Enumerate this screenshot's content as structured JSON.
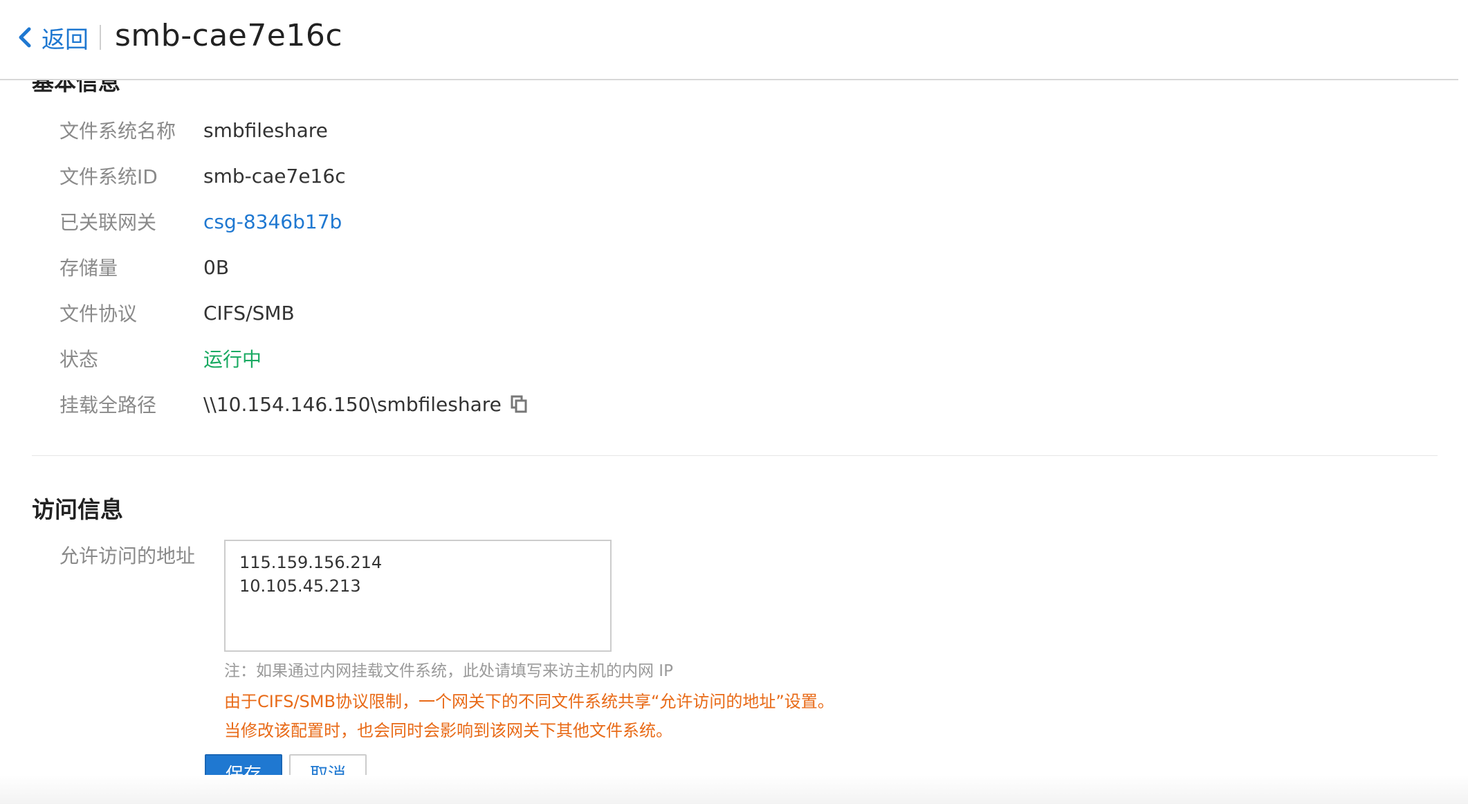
{
  "header": {
    "back_label": "返回",
    "title": "smb-cae7e16c"
  },
  "basic_info": {
    "heading": "基本信息",
    "rows": [
      {
        "label": "文件系统名称",
        "value": "smbfileshare"
      },
      {
        "label": "文件系统ID",
        "value": "smb-cae7e16c"
      },
      {
        "label": "已关联网关",
        "value": "csg-8346b17b"
      },
      {
        "label": "存储量",
        "value": "0B"
      },
      {
        "label": "文件协议",
        "value": "CIFS/SMB"
      },
      {
        "label": "状态",
        "value": "运行中"
      },
      {
        "label": "挂载全路径",
        "value": "\\\\10.154.146.150\\smbfileshare"
      }
    ]
  },
  "access_info": {
    "heading": "访问信息",
    "allowed_label": "允许访问的地址",
    "allowed_ips": [
      "115.159.156.214",
      "10.105.45.213"
    ],
    "note": "注：如果通过内网挂载文件系统，此处请填写来访主机的内网 IP",
    "warning_1": "由于CIFS/SMB协议限制，一个网关下的不同文件系统共享“允许访问的地址”设置。",
    "warning_2": "当修改该配置时，也会同时会影响到该网关下其他文件系统。"
  },
  "actions": {
    "save_label": "保存",
    "cancel_label": "取消"
  },
  "colors": {
    "accent": "#1f78d1",
    "status_running": "#1aaa62",
    "warning": "#e86a17"
  },
  "icons": {
    "back": "chevron-left-icon",
    "copy": "copy-icon"
  }
}
